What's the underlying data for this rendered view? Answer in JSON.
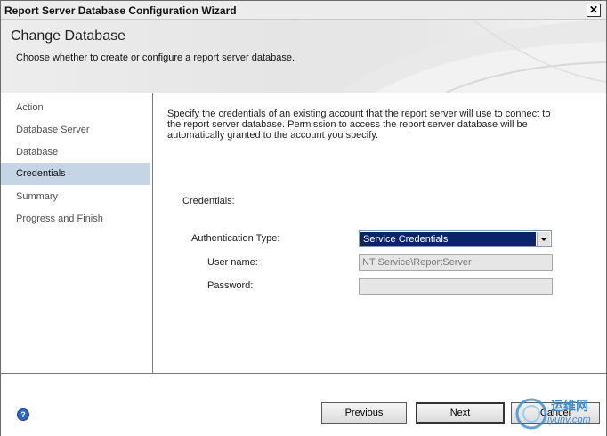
{
  "window": {
    "title": "Report Server Database Configuration Wizard",
    "close_glyph": "✕"
  },
  "header": {
    "title": "Change Database",
    "description": "Choose whether to create or configure a report server database."
  },
  "sidebar": {
    "items": [
      {
        "label": "Action",
        "selected": false
      },
      {
        "label": "Database Server",
        "selected": false
      },
      {
        "label": "Database",
        "selected": false
      },
      {
        "label": "Credentials",
        "selected": true
      },
      {
        "label": "Summary",
        "selected": false
      },
      {
        "label": "Progress and Finish",
        "selected": false
      }
    ]
  },
  "main": {
    "intro": "Specify the credentials of an existing account that the report server will use to connect to the report server database.  Permission to access the report server database will be automatically granted to the account you specify.",
    "section_label": "Credentials:",
    "auth_type_label": "Authentication Type:",
    "auth_type_value": "Service Credentials",
    "username_label": "User name:",
    "username_value": "NT Service\\ReportServer",
    "password_label": "Password:",
    "password_value": ""
  },
  "footer": {
    "help_glyph": "?",
    "previous_label": "Previous",
    "next_label": "Next",
    "cancel_label": "Cancel"
  },
  "watermark": {
    "line1": "运维网",
    "line2": "iyunv.com"
  },
  "colors": {
    "selected_nav_bg": "#c6d5e6",
    "combo_selected_bg": "#0a246a",
    "help_icon": "#2f65c4",
    "watermark": "#3a8bd3"
  }
}
